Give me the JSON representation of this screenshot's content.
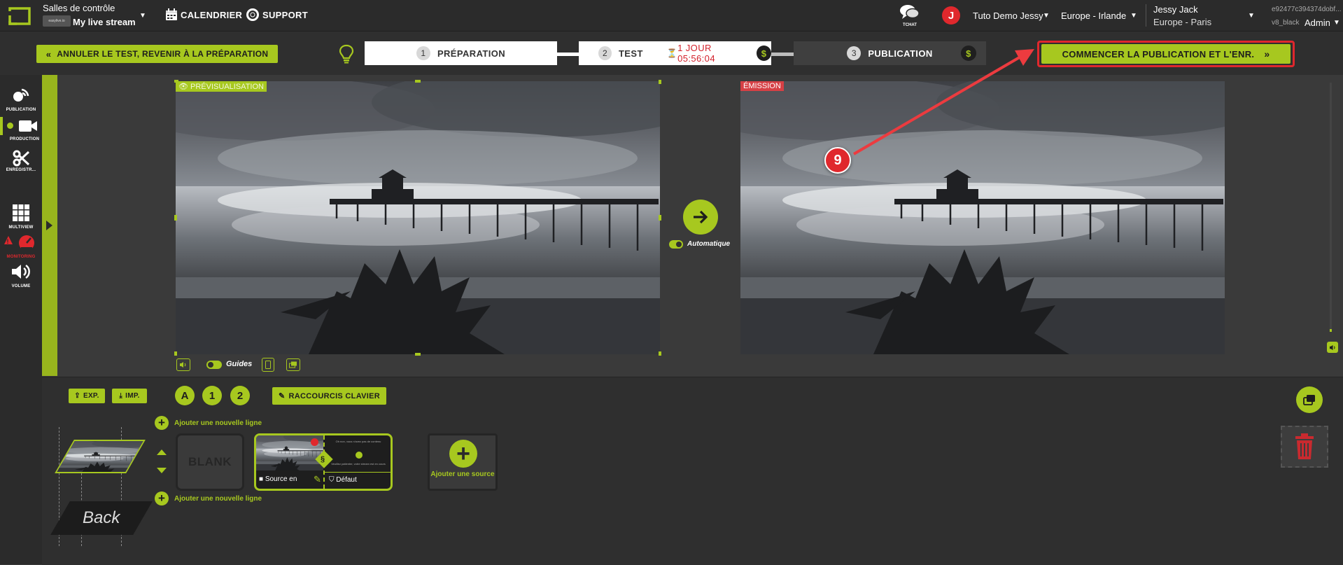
{
  "header": {
    "app_label": "Salles de contrôle",
    "stream_name": "My live stream",
    "brand_badge": "easylive.io",
    "nav": {
      "calendar": "CALENDRIER",
      "support": "SUPPORT"
    },
    "chat_label": "TCHAT",
    "avatar_letter": "J",
    "account_name": "Tuto Demo Jessy",
    "region": "Europe - Irlande",
    "user_name": "Jessy Jack",
    "timezone": "Europe - Paris",
    "session_id": "e92477c394374dobf...",
    "version": "v8_black",
    "role": "Admin"
  },
  "stepbar": {
    "cancel_button": "ANNULER LE TEST, REVENIR À LA PRÉPARATION",
    "steps": [
      {
        "num": "1",
        "label": "PRÉPARATION"
      },
      {
        "num": "2",
        "label": "TEST",
        "timer": "1 JOUR 05:56:04"
      },
      {
        "num": "3",
        "label": "PUBLICATION"
      }
    ],
    "dollar": "$",
    "start_button": "COMMENCER LA PUBLICATION ET L'ENR.",
    "callout_number": "9"
  },
  "sidebar": {
    "items": [
      {
        "label": "PUBLICATION",
        "icon": "broadcast-icon"
      },
      {
        "label": "PRODUCTION",
        "icon": "camera-icon"
      },
      {
        "label": "ENREGISTR...",
        "icon": "scissors-icon"
      },
      {
        "label": "MULTIVIEW",
        "icon": "grid-icon"
      },
      {
        "label": "MONITORING",
        "icon": "gauge-icon"
      },
      {
        "label": "VOLUME",
        "icon": "speaker-icon"
      }
    ]
  },
  "preview": {
    "tag": "PRÉVISUALISATION",
    "guides_label": "Guides"
  },
  "program": {
    "tag": "ÉMISSION"
  },
  "transition": {
    "auto_label": "Automatique"
  },
  "lower": {
    "export_label": "EXP.",
    "import_label": "IMP.",
    "layers": [
      "A",
      "1",
      "2"
    ],
    "shortcuts_label": "RACCOURCIS CLAVIER",
    "add_line_top": "Ajouter une nouvelle ligne",
    "add_line_bottom": "Ajouter une nouvelle ligne",
    "blank_label": "BLANK",
    "back_label": "Back",
    "source_label": "Source en",
    "default_label": "Défaut",
    "add_source_label": "Ajouter une source",
    "card_text_1": "Oh non, vous n'avez pas de contenu",
    "card_text_2": "Veuillez patienter, votre stream est en cours"
  },
  "colors": {
    "accent": "#a7c81f",
    "danger": "#e0282d",
    "background": "#3a3a3a"
  }
}
